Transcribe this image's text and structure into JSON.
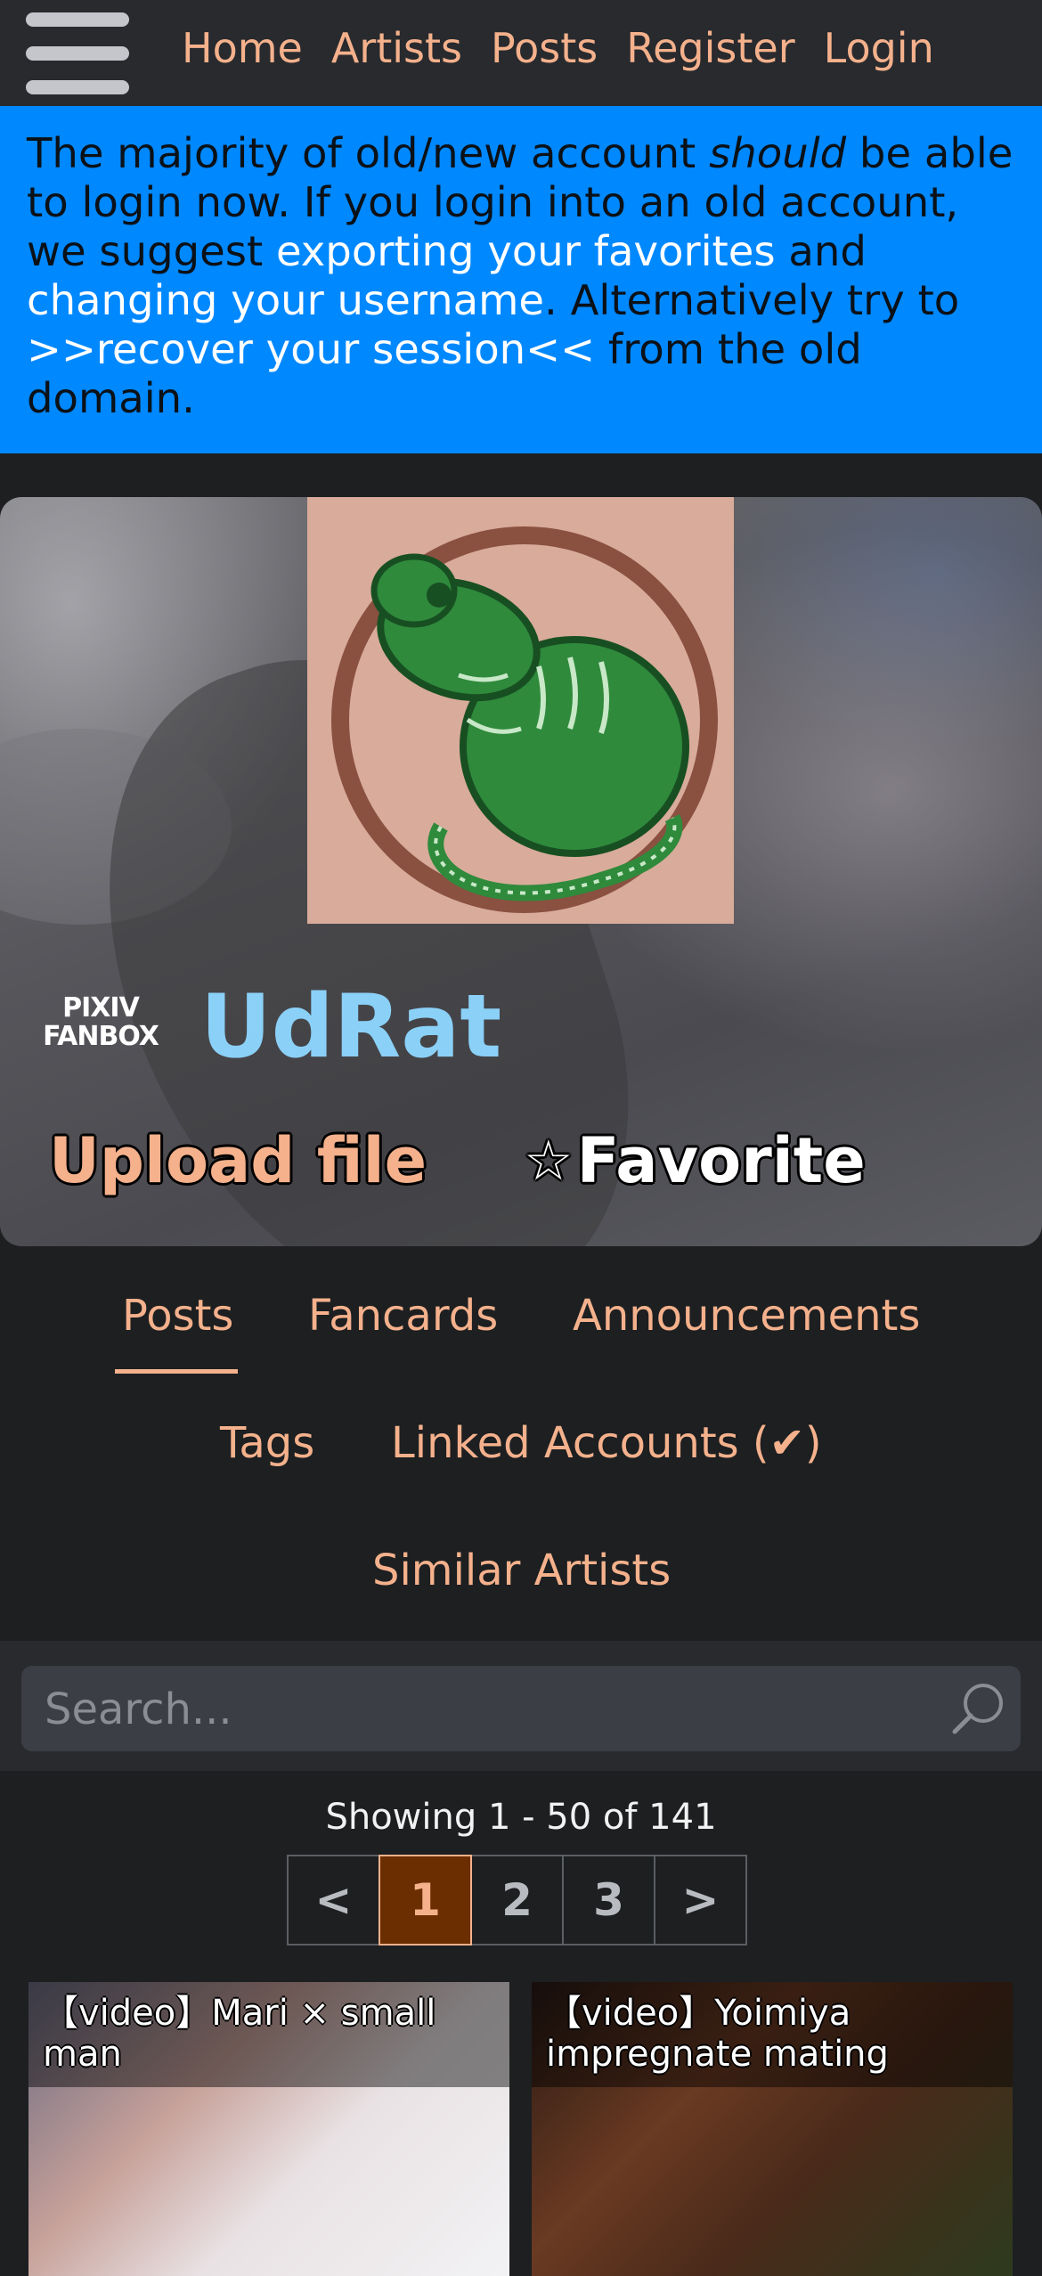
{
  "nav": {
    "links": [
      "Home",
      "Artists",
      "Posts",
      "Register",
      "Login"
    ]
  },
  "banner": {
    "text_1": "The majority of old/new account ",
    "emphasis": "should",
    "text_2": " be able to login now. If you login into an old account, we suggest ",
    "link_export": "exporting your favorites",
    "text_3": " and ",
    "link_username": "changing your username",
    "text_4": ". Alternatively try to ",
    "link_recover": ">>recover your session<<",
    "text_5": " from the old domain."
  },
  "artist": {
    "service_logo_line1": "PIXIV",
    "service_logo_line2": "FANBOX",
    "name": "UdRat",
    "upload_label": "Upload file",
    "favorite_star": "☆",
    "favorite_label": "Favorite"
  },
  "tabs": {
    "posts": "Posts",
    "fancards": "Fancards",
    "announcements": "Announcements",
    "tags": "Tags",
    "linked_accounts": "Linked Accounts (✔)",
    "similar_artists": "Similar Artists"
  },
  "search": {
    "placeholder": "Search..."
  },
  "pagination": {
    "showing": "Showing 1 - 50 of 141",
    "prev": "<",
    "pages": [
      "1",
      "2",
      "3"
    ],
    "next": ">",
    "current": "1"
  },
  "posts": [
    {
      "title": "【video】Mari × small man"
    },
    {
      "title": "【video】Yoimiya impregnate mating"
    }
  ],
  "colors": {
    "accent": "#f4b18c",
    "banner_bg": "#0088ff",
    "artist_name": "#8bd0f7",
    "active_page_bg": "#6b2e00"
  }
}
